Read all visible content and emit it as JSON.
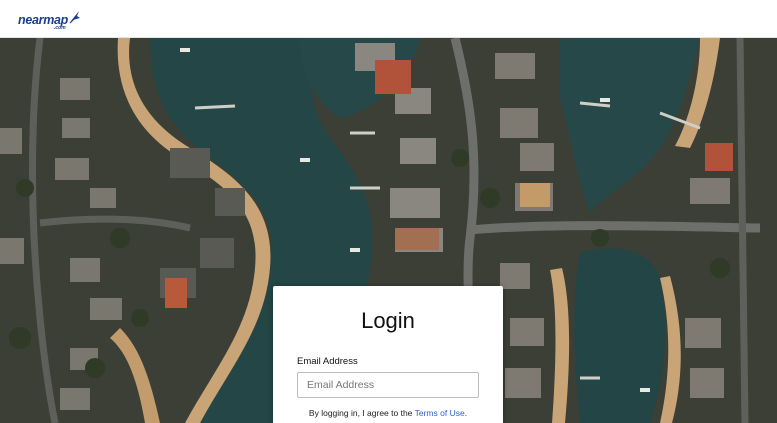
{
  "header": {
    "logo_text": "nearmap",
    "logo_sub": ".com"
  },
  "login": {
    "title": "Login",
    "email_label": "Email Address",
    "email_placeholder": "Email Address",
    "email_value": "",
    "terms_prefix": "By logging in, I agree to the ",
    "terms_link": "Terms of Use",
    "terms_suffix": "."
  },
  "colors": {
    "brand": "#1a3f8f",
    "link": "#2a62c9",
    "water": "#2a4a4a",
    "sand": "#c9a477"
  }
}
